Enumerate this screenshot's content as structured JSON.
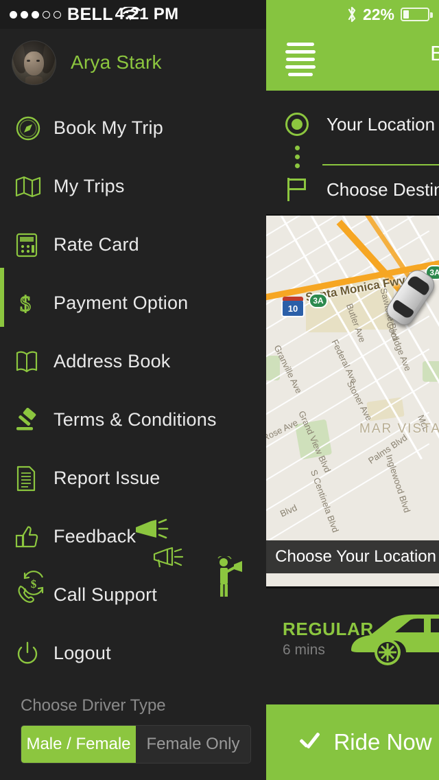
{
  "status_bar": {
    "signal_dots_filled": 3,
    "signal_dots_total": 5,
    "carrier": "BELL",
    "wifi_icon": "wifi-icon",
    "time": "4:21 PM",
    "bluetooth_icon": "bluetooth-icon",
    "battery_percent": "22%",
    "battery_level": 22
  },
  "drawer": {
    "profile": {
      "avatar_icon": "user-avatar",
      "name": "Arya Stark"
    },
    "items": [
      {
        "label": "Book My Trip",
        "icon": "compass-icon"
      },
      {
        "label": "My Trips",
        "icon": "map-folded-icon"
      },
      {
        "label": "Rate Card",
        "icon": "calculator-icon"
      },
      {
        "label": "Payment Option",
        "icon": "dollar-sign-icon"
      },
      {
        "label": "Address Book",
        "icon": "open-book-icon"
      },
      {
        "label": "Terms & Conditions",
        "icon": "gavel-icon"
      },
      {
        "label": "Report Issue",
        "icon": "document-icon"
      },
      {
        "label": "Feedback",
        "icon": "thumbs-up-icon"
      },
      {
        "label": "Call Support",
        "icon": "phone-handset-icon"
      },
      {
        "label": "Logout",
        "icon": "power-icon"
      }
    ],
    "floating_icons": [
      {
        "icon": "megaphone-filled-icon"
      },
      {
        "icon": "megaphone-outline-icon"
      },
      {
        "icon": "person-with-megaphone-icon"
      },
      {
        "icon": "refund-dollar-icon"
      }
    ],
    "driver_type": {
      "label": "Choose Driver Type",
      "options": [
        {
          "label": "Male / Female",
          "selected": true
        },
        {
          "label": "Female Only",
          "selected": false
        }
      ]
    }
  },
  "main": {
    "appbar": {
      "menu_icon": "hamburger-menu-icon",
      "title": "Book My Trip"
    },
    "trip": {
      "origin": {
        "label": "Your Location",
        "icon": "target-location-icon"
      },
      "destination": {
        "label": "Choose Destination",
        "icon": "flag-icon"
      },
      "connector_icon": "vertical-dots-icon"
    },
    "map": {
      "vehicle_marker_icon": "car-top-view-icon",
      "overlay_text": "Choose Your Location",
      "neighborhood": "MAR VISTA",
      "highway_label": "Santa Monica Fwy",
      "shields": [
        {
          "label": "10",
          "type": "interstate"
        },
        {
          "label": "3A",
          "type": "state"
        },
        {
          "label": "3A",
          "type": "state"
        }
      ],
      "street_labels": [
        "Sawtelle Blvd",
        "Butler Ave",
        "Federal Ave",
        "Granville Ave",
        "Coolidge Ave",
        "Stoner Ave",
        "Grand View Blvd",
        "Palms Blvd",
        "Inglewood Blvd",
        "S Centinela Blvd",
        "Rose Ave",
        "Blvd",
        "McL"
      ]
    },
    "ride_type": {
      "name": "REGULAR",
      "eta": "6 mins",
      "icon": "car-side-icon"
    },
    "cta": {
      "label": "Ride Now",
      "icon": "check-icon"
    }
  },
  "colors": {
    "accent_green": "#86c440",
    "accent_green_text": "#8cc63f",
    "background_dark": "#222222",
    "statusbar_dark": "#1c1c1c",
    "text_primary": "#e9e9e9",
    "text_muted": "#8a8a8a",
    "map_land": "#ece9e2",
    "highway_orange": "#f6a623"
  }
}
